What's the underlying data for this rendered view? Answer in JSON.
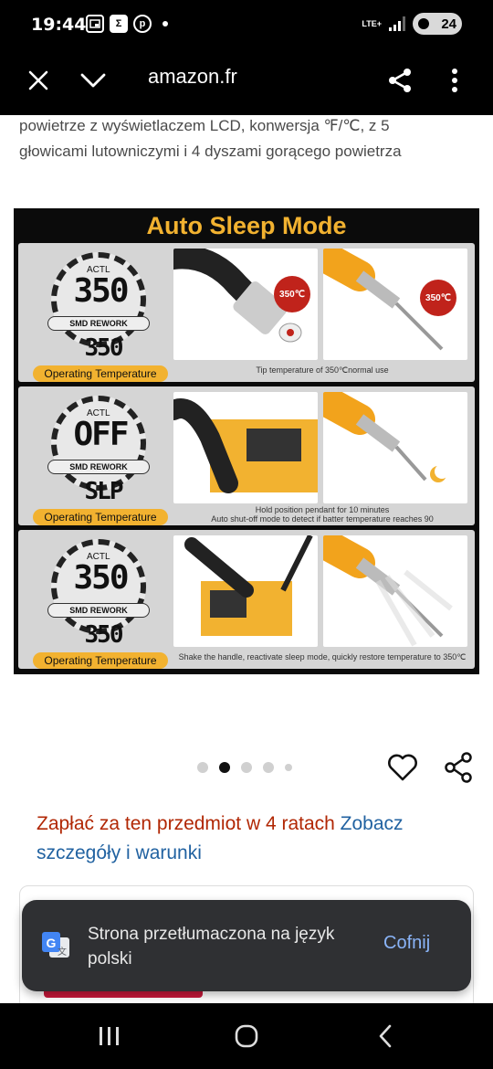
{
  "status_bar": {
    "time": "19:44",
    "notification_icons": [
      "picture-in-picture-icon",
      "app-square-icon",
      "pinterest-icon"
    ],
    "network": "LTE+",
    "battery": "24"
  },
  "browser": {
    "url": "amazon.fr",
    "close_icon": "close-icon",
    "collapse_icon": "chevron-down-icon",
    "share_icon": "share-icon",
    "menu_icon": "more-vert-icon"
  },
  "product": {
    "description_line1": "powietrze z wyświetlaczem LCD, konwersja ℉/℃, z 5",
    "description_line2": "głowicami lutowniczymi i 4 dyszami gorącego powietrza",
    "image": {
      "title": "Auto Sleep Mode",
      "panels": [
        {
          "actl": "ACTL",
          "display": "350",
          "mode": "SMD REWORK",
          "set_value": "350",
          "label": "Operating Temperature",
          "badge_left": "350℃",
          "badge_right": "350℃",
          "caption": "Tip temperature of 350℃normal use"
        },
        {
          "actl": "ACTL",
          "display": "OFF",
          "mode": "SMD REWORK",
          "set_value": "SLP",
          "label": "Operating Temperature",
          "caption": "Hold position pendant for 10 minutes",
          "caption2": "Auto shut-off mode to detect if batter temperature reaches 90"
        },
        {
          "actl": "ACTL",
          "display": "350",
          "mode": "SMD REWORK",
          "set_value": "350",
          "label": "Operating Temperature",
          "caption": "Shake the handle, reactivate sleep mode, quickly restore temperature to 350℃"
        }
      ]
    },
    "carousel": {
      "count": 5,
      "active_index": 1
    },
    "wishlist_icon": "heart-icon",
    "share_icon": "share-icon"
  },
  "payment": {
    "text": "Zapłać za ten przedmiot w 4 ratach",
    "link": "Zobacz szczegóły i warunki"
  },
  "toast": {
    "text": "Strona przetłumaczona na język polski",
    "action": "Cofnij",
    "icon": "google-translate-icon"
  },
  "nav_bar": {
    "recents_icon": "recents-icon",
    "home_icon": "home-icon",
    "back_icon": "back-icon"
  },
  "colors": {
    "accent_orange": "#f2b230",
    "price_red": "#b12704",
    "link_blue": "#2162a1",
    "toast_bg": "#2f3033",
    "toast_action": "#8ab4f8"
  }
}
